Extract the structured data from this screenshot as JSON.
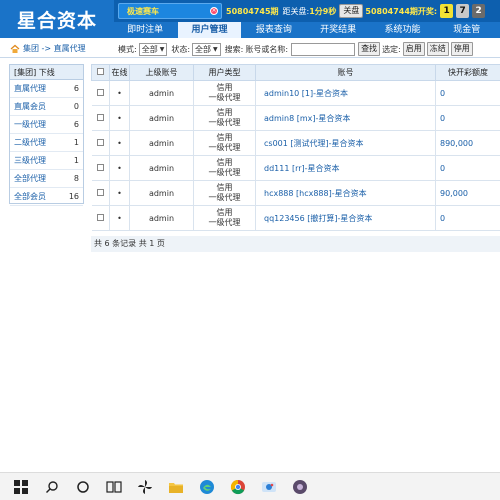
{
  "header": {
    "logo": "星合资本",
    "game": "极速赛车",
    "current_draw": "50804745期",
    "close_label": "距关盘:",
    "close_time": "1分9秒",
    "close_button": "关盘",
    "prev_draw": "50804744期",
    "prev_label": "开奖:",
    "balls": [
      "1",
      "7",
      "2"
    ],
    "nav": [
      "即时注单",
      "用户管理",
      "报表查询",
      "开奖结果",
      "系统功能",
      "现金管"
    ]
  },
  "breadcrumb": "集团 -> 直属代理",
  "filters": {
    "mode_label": "模式:",
    "mode_value": "全部",
    "status_label": "状态:",
    "status_value": "全部",
    "search_label": "搜索:",
    "search_placeholder": "账号或名称:",
    "search_button": "查找",
    "selected_label": "选定:",
    "enable_button": "启用",
    "freeze_button": "冻结",
    "disable_button": "停用"
  },
  "sidebar": {
    "title": "[集团] 下线",
    "items": [
      {
        "label": "直属代理",
        "count": "6"
      },
      {
        "label": "直属会员",
        "count": "0"
      },
      {
        "label": "一级代理",
        "count": "6"
      },
      {
        "label": "二级代理",
        "count": "1"
      },
      {
        "label": "三级代理",
        "count": "1"
      },
      {
        "label": "全部代理",
        "count": "8"
      },
      {
        "label": "全部会员",
        "count": "16"
      }
    ]
  },
  "table": {
    "headers": [
      "",
      "在线",
      "上级账号",
      "用户类型",
      "账号",
      "快开彩额度"
    ],
    "rows": [
      {
        "online": "•",
        "parent": "admin",
        "type1": "信用",
        "type2": "一级代理",
        "account": "admin10 [1]-星合资本",
        "limit": "0"
      },
      {
        "online": "•",
        "parent": "admin",
        "type1": "信用",
        "type2": "一级代理",
        "account": "admin8 [mx]-星合资本",
        "limit": "0"
      },
      {
        "online": "•",
        "parent": "admin",
        "type1": "信用",
        "type2": "一级代理",
        "account": "cs001 [测试代理]-星合资本",
        "limit": "890,000"
      },
      {
        "online": "•",
        "parent": "admin",
        "type1": "信用",
        "type2": "一级代理",
        "account": "dd111 [rr]-星合资本",
        "limit": "0"
      },
      {
        "online": "•",
        "parent": "admin",
        "type1": "信用",
        "type2": "一级代理",
        "account": "hcx888 [hcx888]-星合资本",
        "limit": "90,000"
      },
      {
        "online": "•",
        "parent": "admin",
        "type1": "信用",
        "type2": "一级代理",
        "account": "qq123456 [撤打算]-星合资本",
        "limit": "0"
      }
    ],
    "footer": "共 6 条记录 共 1 页"
  },
  "taskbar": {
    "icons": [
      "windows-start-icon",
      "search-icon",
      "cortana-icon",
      "task-view-icon",
      "pinwheel-icon",
      "file-explorer-icon",
      "edge-icon",
      "chrome-icon",
      "photos-icon",
      "media-icon"
    ]
  }
}
